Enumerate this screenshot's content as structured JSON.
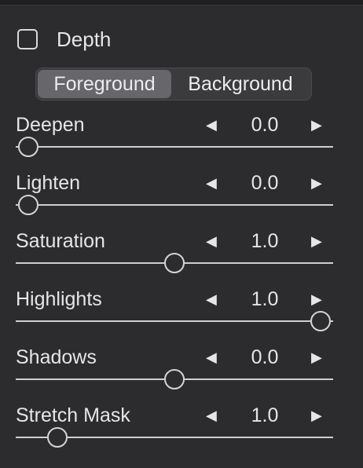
{
  "depth": {
    "label": "Depth",
    "checked": false
  },
  "tabs": [
    {
      "label": "Foreground",
      "selected": true
    },
    {
      "label": "Background",
      "selected": false
    }
  ],
  "arrows": {
    "left": "◀",
    "right": "▶"
  },
  "sliders": [
    {
      "label": "Deepen",
      "value": "0.0",
      "level": 0.04
    },
    {
      "label": "Lighten",
      "value": "0.0",
      "level": 0.04
    },
    {
      "label": "Saturation",
      "value": "1.0",
      "level": 0.5
    },
    {
      "label": "Highlights",
      "value": "1.0",
      "level": 0.96
    },
    {
      "label": "Shadows",
      "value": "0.0",
      "level": 0.5
    },
    {
      "label": "Stretch Mask",
      "value": "1.0",
      "level": 0.13
    }
  ]
}
